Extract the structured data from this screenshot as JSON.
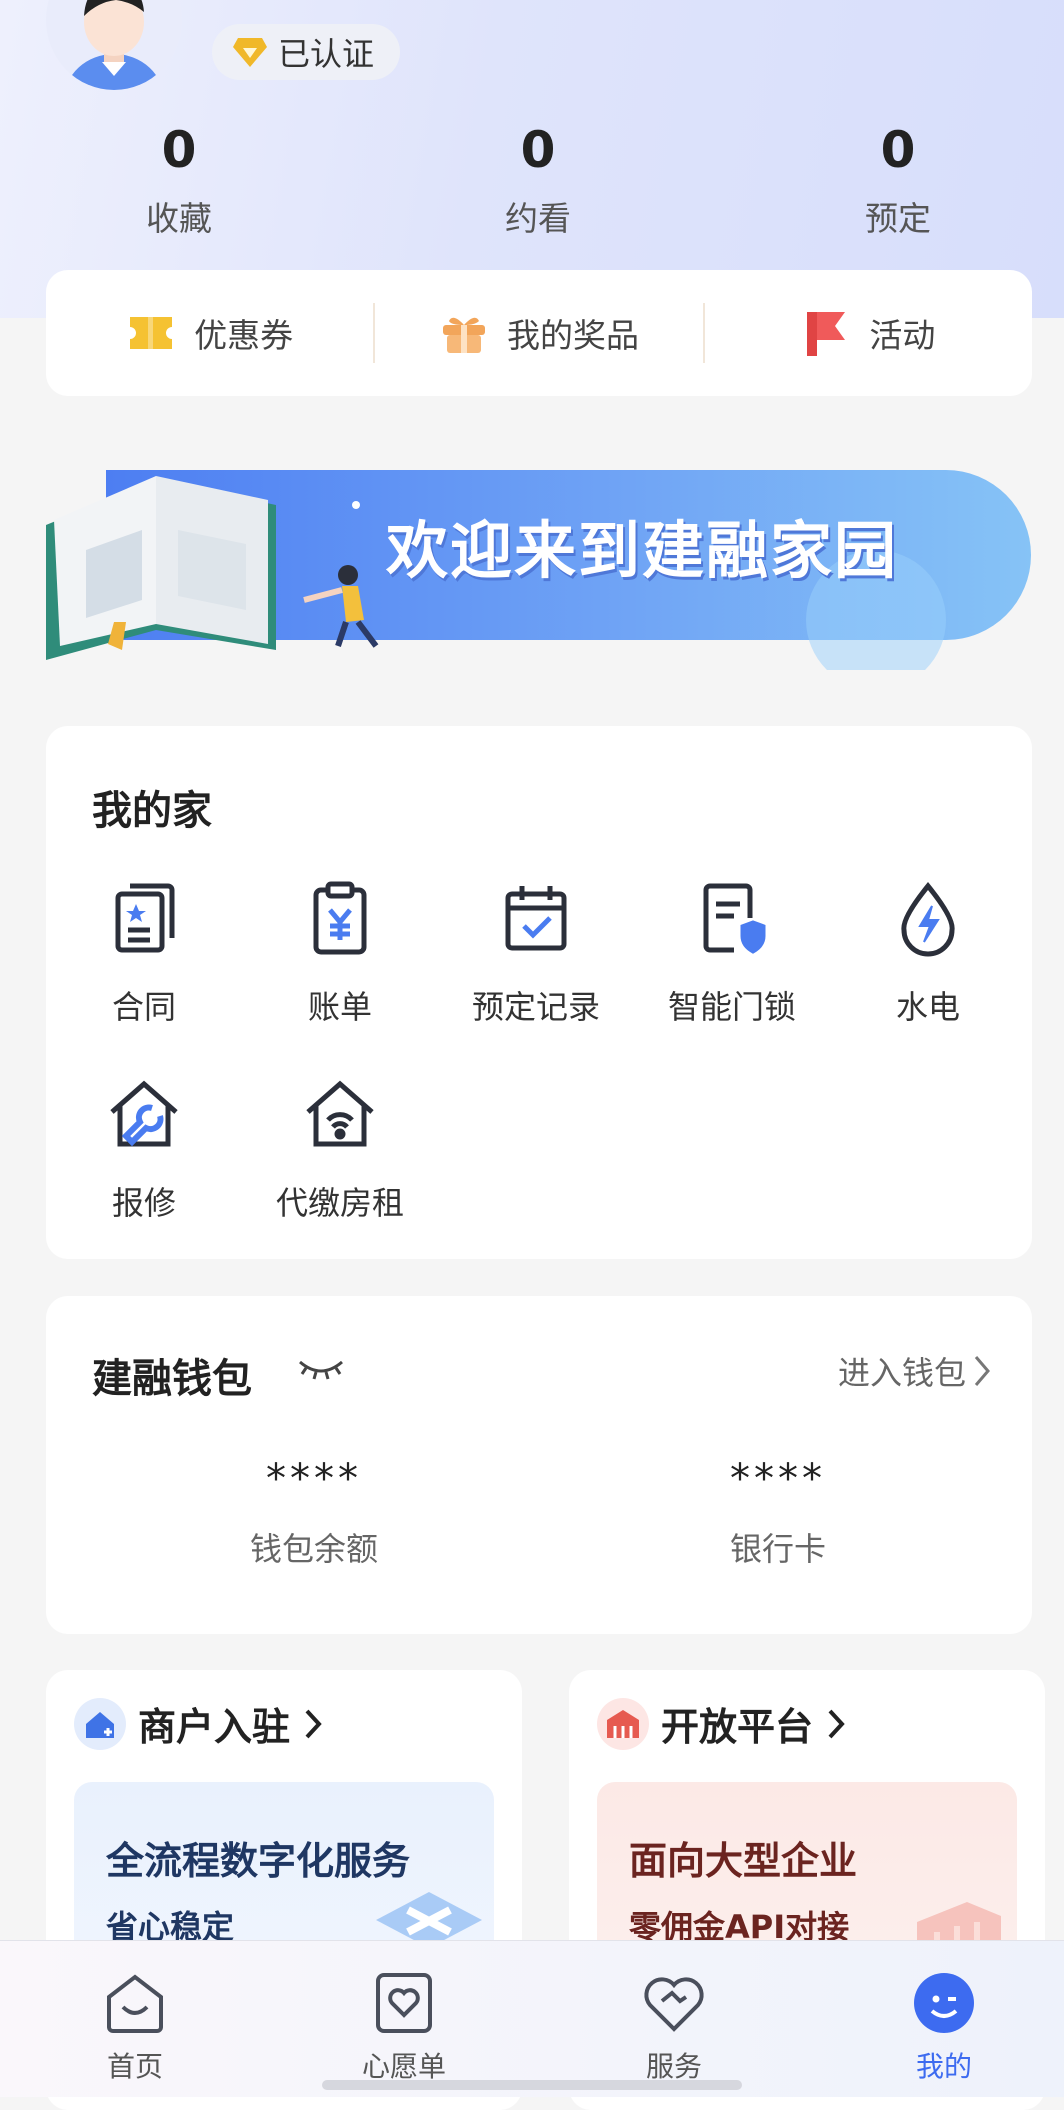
{
  "profile": {
    "badge": "已认证"
  },
  "stats": [
    {
      "value": "0",
      "label": "收藏"
    },
    {
      "value": "0",
      "label": "约看"
    },
    {
      "value": "0",
      "label": "预定"
    }
  ],
  "quick": [
    {
      "label": "优惠券",
      "icon": "coupon-icon"
    },
    {
      "label": "我的奖品",
      "icon": "gift-icon"
    },
    {
      "label": "活动",
      "icon": "flag-icon"
    }
  ],
  "banner": {
    "text": "欢迎来到建融家园"
  },
  "home": {
    "title": "我的家",
    "items": [
      {
        "label": "合同",
        "icon": "contract-icon"
      },
      {
        "label": "账单",
        "icon": "bill-icon"
      },
      {
        "label": "预定记录",
        "icon": "calendar-icon"
      },
      {
        "label": "智能门锁",
        "icon": "smart-lock-icon"
      },
      {
        "label": "水电",
        "icon": "water-electric-icon"
      },
      {
        "label": "报修",
        "icon": "repair-icon"
      },
      {
        "label": "代缴房租",
        "icon": "rent-icon"
      }
    ]
  },
  "wallet": {
    "title": "建融钱包",
    "link": "进入钱包",
    "balance": {
      "value": "****",
      "label": "钱包余额"
    },
    "card": {
      "value": "****",
      "label": "银行卡"
    }
  },
  "promos": [
    {
      "title": "商户入驻",
      "headline": "全流程数字化服务",
      "sub": "省心稳定",
      "color": "#1f3763"
    },
    {
      "title": "开放平台",
      "headline": "面向大型企业",
      "sub": "零佣金API对接",
      "color": "#6b2420"
    }
  ],
  "tabs": [
    {
      "label": "首页",
      "icon": "home-icon"
    },
    {
      "label": "心愿单",
      "icon": "wishlist-icon"
    },
    {
      "label": "服务",
      "icon": "service-icon"
    },
    {
      "label": "我的",
      "icon": "me-icon",
      "active": true
    }
  ],
  "colors": {
    "accent": "#3d7cf2",
    "active_tab": "#3d6bf0",
    "icon_stroke": "#2b2f3a"
  }
}
